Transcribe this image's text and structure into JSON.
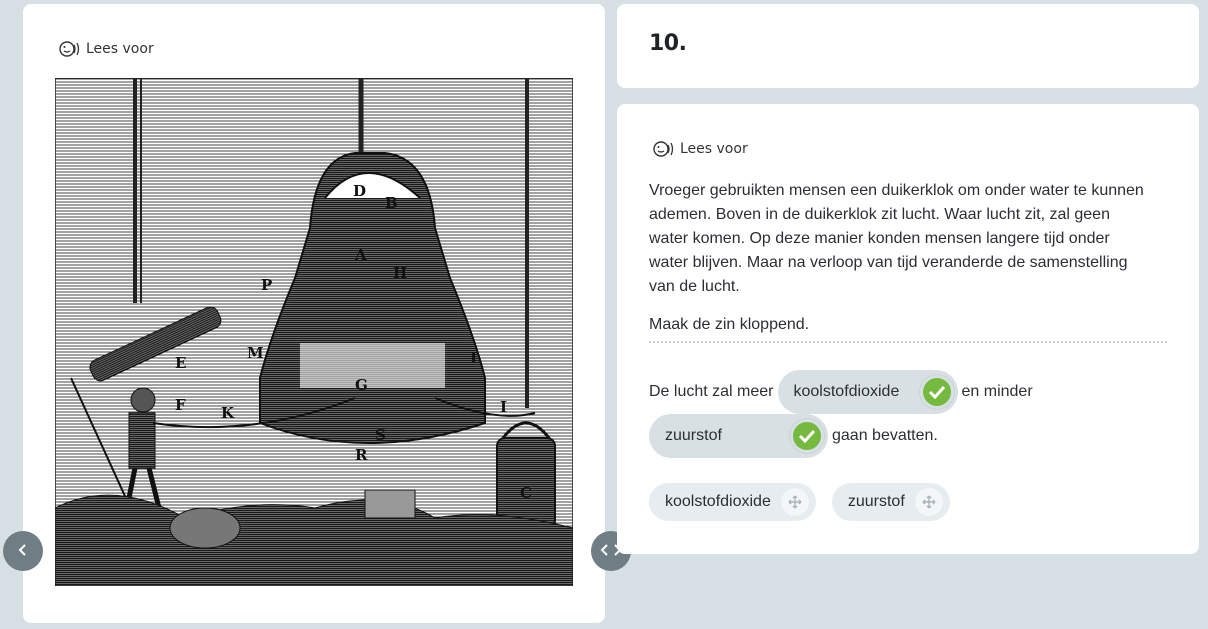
{
  "read_aloud_label": "Lees voor",
  "question": {
    "number": "10."
  },
  "passage": "Vroeger gebruikten mensen een duikerklok om onder water te kunnen ademen. Boven in de duikerklok zit lucht. Waar lucht zit, zal geen water komen. Op deze manier konden mensen langere tijd onder water blijven. Maar na verloop van tijd veranderde de samenstelling van de lucht.",
  "instruction": "Maak de zin kloppend.",
  "sentence": {
    "part1": "De lucht zal meer",
    "blank1": "koolstofdioxide",
    "part2": "en minder",
    "blank2": "zuurstof",
    "part3": "gaan bevatten."
  },
  "options": [
    "koolstofdioxide",
    "zuurstof"
  ],
  "illustration_labels": [
    "D",
    "B",
    "A",
    "H",
    "P",
    "M",
    "E",
    "F",
    "K",
    "G",
    "S",
    "R",
    "L",
    "I",
    "C"
  ],
  "colors": {
    "background": "#d6e0e4",
    "check": "#76b93f",
    "chip": "#e6ecef",
    "nav": "#6f7d85"
  },
  "icons": {
    "read_aloud": "speaker-face-icon",
    "prev": "chevron-left-icon",
    "resize": "chevrons-horizontal-icon",
    "check": "checkmark-icon",
    "move": "move-arrows-icon"
  }
}
